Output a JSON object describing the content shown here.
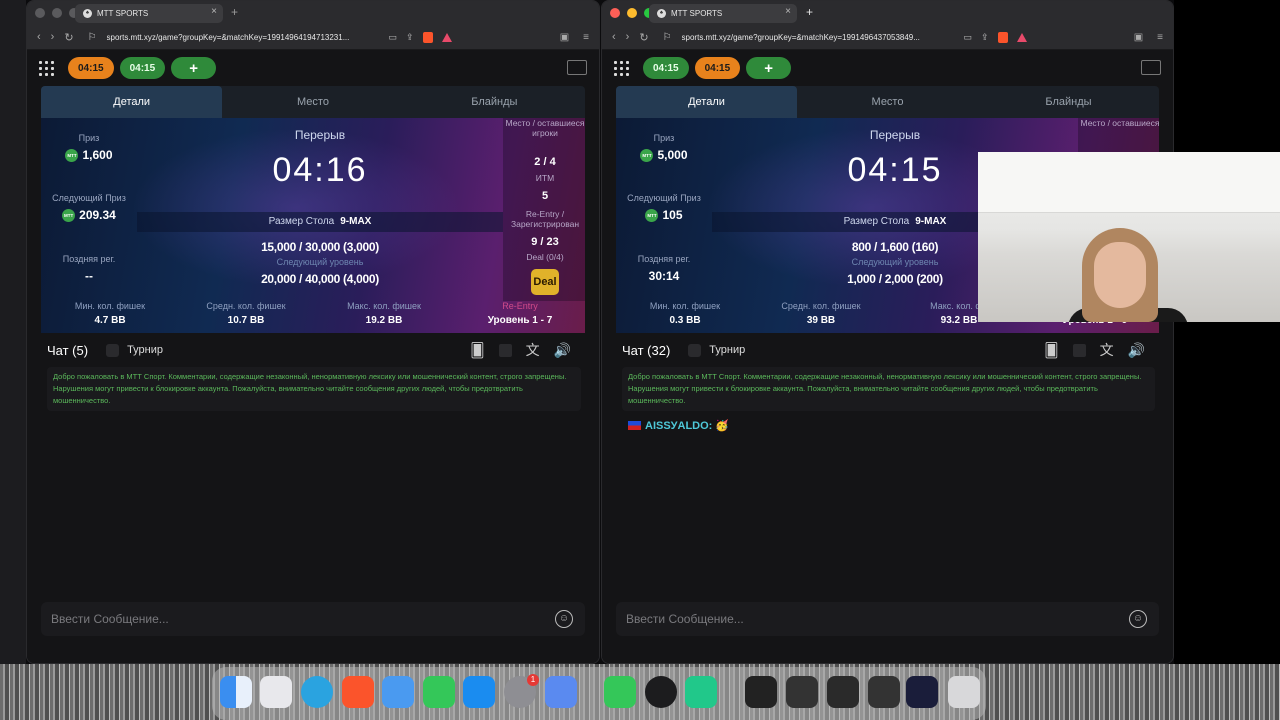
{
  "left_window": {
    "tab_title": "MTT SPORTS",
    "url": "sports.mtt.xyz/game?groupKey=&matchKey=19914964194713231...",
    "timers": [
      "04:15",
      "04:15"
    ],
    "tabs": [
      "Детали",
      "Место",
      "Блайнды"
    ],
    "prize_label": "Приз",
    "prize": "1,600",
    "next_prize_label": "Следующий Приз",
    "next_prize": "209.34",
    "late_reg_label": "Поздняя рег.",
    "late_reg": "--",
    "break_label": "Перерыв",
    "clock": "04:16",
    "table_size_label": "Размер Стола",
    "table_size": "9-MAX",
    "blinds": "15,000 / 30,000 (3,000)",
    "next_level_label": "Следующий уровень",
    "next_blinds": "20,000 / 40,000 (4,000)",
    "remaining_label": "Место / оставшиеся игроки",
    "remaining": "2 / 4",
    "itm_label": "ИТМ",
    "itm": "5",
    "reentry_label": "Re-Entry / Зарегистрирован",
    "reentry": "9 / 23",
    "deal_label": "Deal (0/4)",
    "deal_button": "Deal",
    "reentry_tag": "Re-Entry",
    "min_chips_label": "Мин. кол. фишек",
    "min_chips": "4.7 BB",
    "avg_chips_label": "Средн. кол. фишек",
    "avg_chips": "10.7 BB",
    "max_chips_label": "Макс. кол. фишек",
    "max_chips": "19.2 BB",
    "level": "Уровень 1 - 7",
    "chat_title": "Чат (5)",
    "tournament_label": "Турнир",
    "welcome": "Добро пожаловать в МТТ Спорт. Комментарии, содержащие незаконный, ненормативную лексику или мошеннический контент, строго запрещены. Нарушения могут привести к блокировке аккаунта. Пожалуйста, внимательно читайте сообщения других людей, чтобы предотвратить мошенничество.",
    "input_placeholder": "Ввести Сообщение..."
  },
  "right_window": {
    "tab_title": "MTT SPORTS",
    "url": "sports.mtt.xyz/game?groupKey=&matchKey=1991496437053849...",
    "timers": [
      "04:15",
      "04:15"
    ],
    "tabs": [
      "Детали",
      "Место",
      "Блайнды"
    ],
    "prize_label": "Приз",
    "prize": "5,000",
    "next_prize_label": "Следующий Приз",
    "next_prize": "105",
    "late_reg_label": "Поздняя рег.",
    "late_reg": "30:14",
    "break_label": "Перерыв",
    "clock": "04:15",
    "table_size_label": "Размер Стола",
    "table_size": "9-MAX",
    "blinds": "800 / 1,600 (160)",
    "next_level_label": "Следующий уровень",
    "next_blinds": "1,000 / 2,000 (200)",
    "remaining_label": "Место / оставшиеся",
    "min_chips_label": "Мин. кол. фишек",
    "min_chips": "0.3 BB",
    "avg_chips_label": "Средн. кол. фишек",
    "avg_chips": "39 BB",
    "max_chips_label": "Макс. кол. фи",
    "max_chips": "93.2 BB",
    "level": "Уровень 1 - 9",
    "chat_title": "Чат (32)",
    "tournament_label": "Турнир",
    "welcome": "Добро пожаловать в МТТ Спорт. Комментарии, содержащие незаконный, ненормативную лексику или мошеннический контент, строго запрещены. Нарушения могут привести к блокировке аккаунта. Пожалуйста, внимательно читайте сообщения других людей, чтобы предотвратить мошенничество.",
    "message": "AISSУALDO: 🥳",
    "input_placeholder": "Ввести Сообщение..."
  },
  "dock": {
    "badge": "1",
    "apps": [
      "finder-icon",
      "launchpad-icon",
      "telegram-icon",
      "brave-icon",
      "mail-icon",
      "facetime-icon",
      "app-store-icon",
      "settings-icon",
      "iphone-mirroring-icon",
      "phone-icon",
      "obs-icon",
      "tradingview-icon",
      "trash-icon"
    ]
  },
  "colors": {
    "accent_orange": "#e8821c",
    "accent_green": "#2f8a3a",
    "chat_green": "#5bb85b",
    "username": "#4ec8d8"
  }
}
